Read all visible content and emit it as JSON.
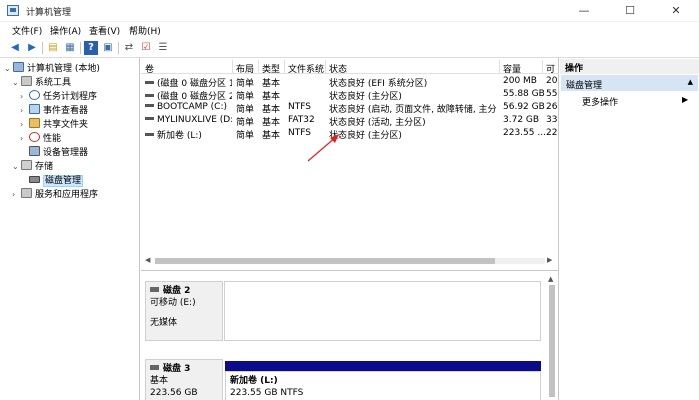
{
  "window": {
    "title": "计算机管理",
    "minimize_glyph": "—",
    "maximize_glyph": "☐",
    "close_glyph": "✕"
  },
  "menu": [
    "文件(F)",
    "操作(A)",
    "查看(V)",
    "帮助(H)"
  ],
  "toolbar": {
    "icons": [
      "back-arrow-icon",
      "forward-arrow-icon",
      "up-folder-icon",
      "show-tree-icon",
      "help-icon",
      "console-icon",
      "connect-icon",
      "properties-icon",
      "view-icon"
    ]
  },
  "tree": {
    "root": "计算机管理 (本地)",
    "system_tools": "系统工具",
    "task_scheduler": "任务计划程序",
    "event_viewer": "事件查看器",
    "shared_folders": "共享文件夹",
    "performance": "性能",
    "device_manager": "设备管理器",
    "storage": "存储",
    "disk_management": "磁盘管理",
    "services": "服务和应用程序"
  },
  "volumes": {
    "columns": [
      "卷",
      "布局",
      "类型",
      "文件系统",
      "状态",
      "容量",
      "可"
    ],
    "rows": [
      {
        "name": "(磁盘 0 磁盘分区 1)",
        "layout": "简单",
        "type": "基本",
        "fs": "",
        "status": "状态良好 (EFI 系统分区)",
        "capacity": "200 MB",
        "free": "20"
      },
      {
        "name": "(磁盘 0 磁盘分区 2)",
        "layout": "简单",
        "type": "基本",
        "fs": "",
        "status": "状态良好 (主分区)",
        "capacity": "55.88 GB",
        "free": "55"
      },
      {
        "name": "BOOTCAMP (C:)",
        "layout": "简单",
        "type": "基本",
        "fs": "NTFS",
        "status": "状态良好 (启动, 页面文件, 故障转储, 主分区)",
        "capacity": "56.92 GB",
        "free": "26"
      },
      {
        "name": "MYLINUXLIVE (D:)",
        "layout": "简单",
        "type": "基本",
        "fs": "FAT32",
        "status": "状态良好 (活动, 主分区)",
        "capacity": "3.72 GB",
        "free": "33"
      },
      {
        "name": "新加卷 (L:)",
        "layout": "简单",
        "type": "基本",
        "fs": "NTFS",
        "status": "状态良好 (主分区)",
        "capacity": "223.55 ...",
        "free": "22"
      }
    ]
  },
  "disks": {
    "disk2": {
      "name": "磁盘 2",
      "kind": "可移动 (E:)",
      "media": "无媒体"
    },
    "disk3": {
      "name": "磁盘 3",
      "kind": "基本",
      "size": "223.56 GB"
    },
    "partition": {
      "name": "新加卷 (L:)",
      "size_fs": "223.55 GB NTFS"
    }
  },
  "actions": {
    "header": "操作",
    "section": "磁盘管理",
    "more": "更多操作",
    "more_arrow": "▶"
  },
  "colors": {
    "partition_bar": "#0c0c8a",
    "selection": "#cce8ff",
    "actions_selected": "#d6e5f5",
    "annotation_arrow": "#e02020"
  }
}
